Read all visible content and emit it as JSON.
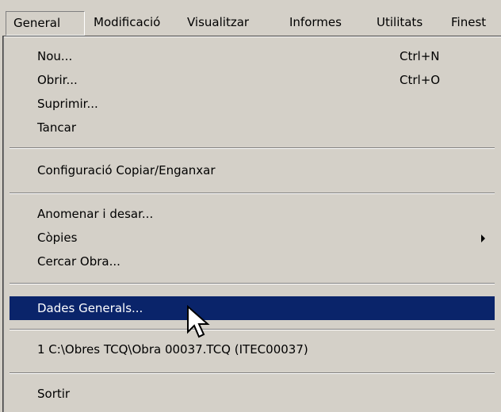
{
  "menubar": {
    "items": [
      {
        "label": "General"
      },
      {
        "label": "Modificació"
      },
      {
        "label": "Visualitzar"
      },
      {
        "label": "Informes"
      },
      {
        "label": "Utilitats"
      },
      {
        "label": "Finest"
      }
    ],
    "active_index": 0
  },
  "menu": {
    "items": [
      {
        "label": "Nou...",
        "shortcut": "Ctrl+N"
      },
      {
        "label": "Obrir...",
        "shortcut": "Ctrl+O"
      },
      {
        "label": "Suprimir..."
      },
      {
        "label": "Tancar"
      },
      {
        "label": "Configuració Copiar/Enganxar"
      },
      {
        "label": "Anomenar i desar..."
      },
      {
        "label": "Còpies",
        "submenu": true
      },
      {
        "label": "Cercar Obra..."
      },
      {
        "label": "Dades Generals...",
        "highlighted": true
      },
      {
        "label": "1 C:\\Obres TCQ\\Obra 00037.TCQ (ITEC00037)"
      },
      {
        "label": "Sortir"
      }
    ]
  },
  "colors": {
    "face": "#d4d0c8",
    "highlight": "#0a246a",
    "highlight_text": "#ffffff"
  },
  "cursor_icon": "arrow-pointer-icon"
}
